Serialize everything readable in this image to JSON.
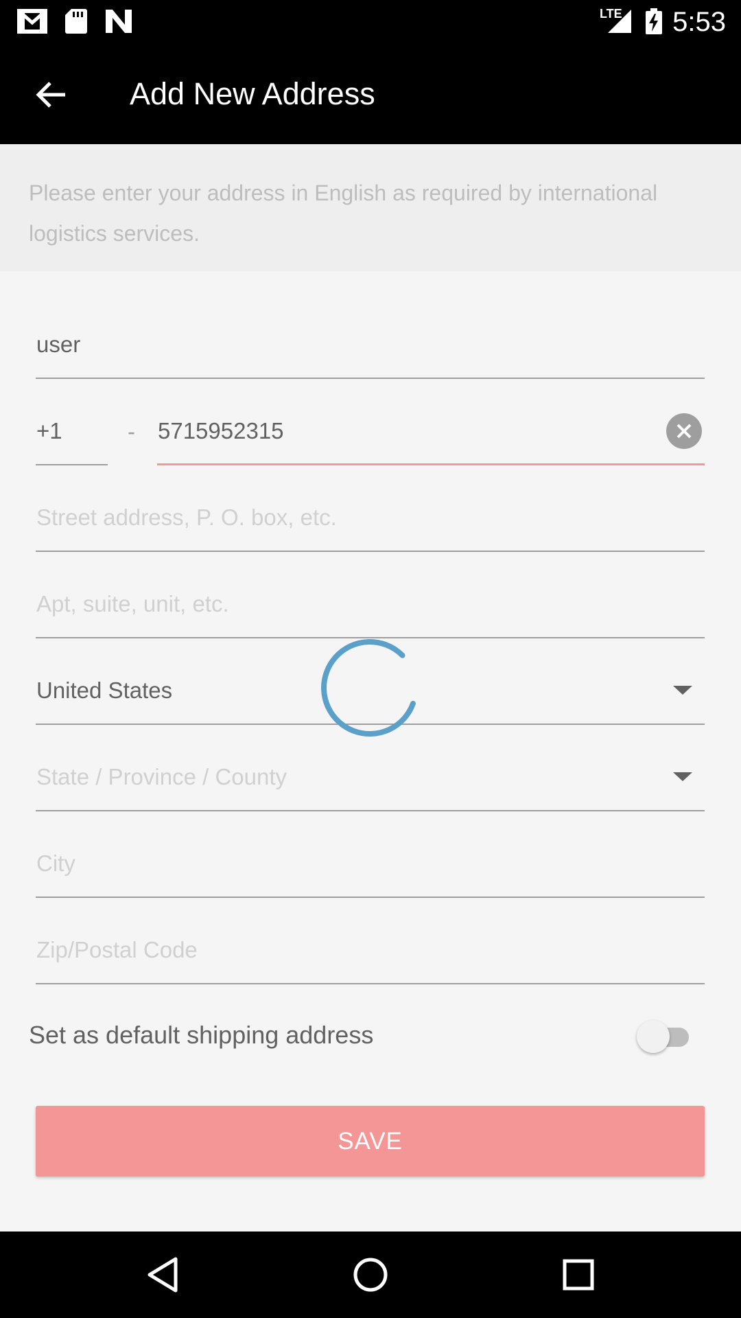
{
  "status_bar": {
    "time": "5:53",
    "network": "LTE",
    "icons": [
      "gmail-icon",
      "sd-card-icon",
      "n-icon",
      "lte-signal-icon",
      "battery-charging-icon"
    ]
  },
  "toolbar": {
    "title": "Add New Address",
    "back_icon": "arrow-back-icon"
  },
  "notice": {
    "text": "Please enter your address in English as required by international logistics services."
  },
  "form": {
    "name_value": "user",
    "country_code": "+1",
    "separator": "-",
    "phone_value": "5715952315",
    "street_placeholder": "Street address, P. O. box, etc.",
    "apt_placeholder": "Apt, suite, unit, etc.",
    "country_value": "United States",
    "state_placeholder": "State / Province / County",
    "city_placeholder": "City",
    "zip_placeholder": "Zip/Postal Code",
    "default_label": "Set as default shipping address",
    "default_on": false,
    "save_label": "SAVE"
  },
  "colors": {
    "accent": "#f49696",
    "spinner": "#5ba0c9",
    "text": "#616161",
    "placeholder": "#d0d0d0"
  }
}
